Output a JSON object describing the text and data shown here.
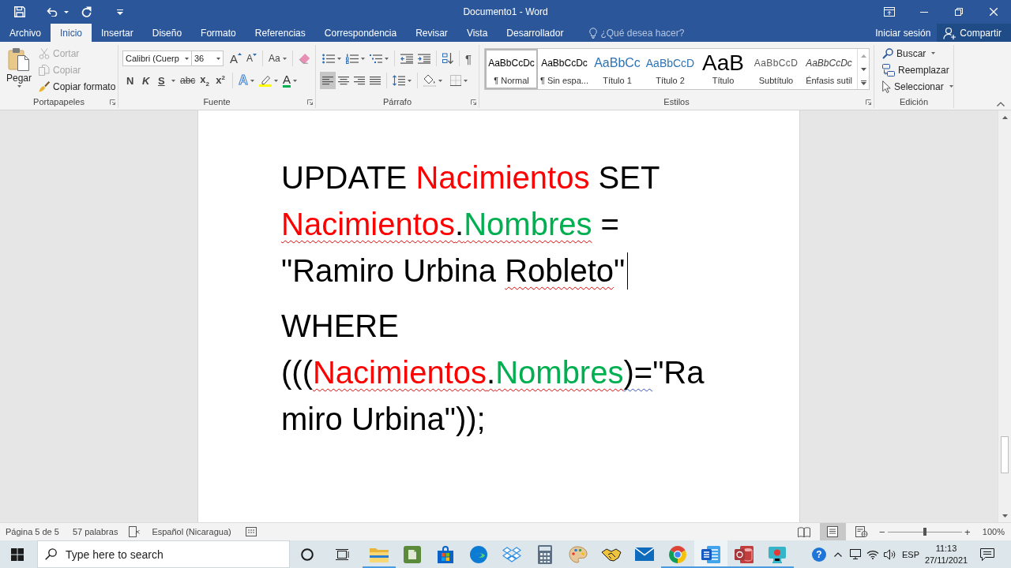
{
  "window": {
    "title": "Documento1 - Word"
  },
  "tabs": [
    {
      "label": "Archivo",
      "selected": false
    },
    {
      "label": "Inicio",
      "selected": true
    },
    {
      "label": "Insertar",
      "selected": false
    },
    {
      "label": "Diseño",
      "selected": false
    },
    {
      "label": "Formato",
      "selected": false
    },
    {
      "label": "Referencias",
      "selected": false
    },
    {
      "label": "Correspondencia",
      "selected": false
    },
    {
      "label": "Revisar",
      "selected": false
    },
    {
      "label": "Vista",
      "selected": false
    },
    {
      "label": "Desarrollador",
      "selected": false
    }
  ],
  "tell_me": {
    "placeholder": "¿Qué desea hacer?"
  },
  "account": {
    "sign_in": "Iniciar sesión",
    "share": "Compartir"
  },
  "ribbon": {
    "clipboard": {
      "label": "Portapapeles",
      "paste": "Pegar",
      "items": [
        {
          "kind": "cut",
          "label": "Cortar",
          "disabled": true
        },
        {
          "kind": "copy",
          "label": "Copiar",
          "disabled": true
        },
        {
          "kind": "format-painter",
          "label": "Copiar formato",
          "disabled": false
        }
      ]
    },
    "font": {
      "label": "Fuente",
      "font_name": "Calibri (Cuerp",
      "font_size": "36",
      "grow": "A",
      "shrink": "A",
      "change_case": "Aa",
      "styles": [
        {
          "kind": "bold",
          "label": "N"
        },
        {
          "kind": "italic",
          "label": "K"
        },
        {
          "kind": "underline",
          "label": "S"
        },
        {
          "kind": "strike",
          "label": "abc"
        },
        {
          "kind": "sub",
          "label": "x$_{2}$"
        },
        {
          "kind": "super",
          "label": "x$^{2}$"
        }
      ],
      "text_effects": "A",
      "font_color": "A"
    },
    "paragraph": {
      "label": "Párrafo",
      "marks": "¶",
      "alignment": [
        {
          "kind": "left",
          "selected": true
        },
        {
          "kind": "center",
          "selected": false
        },
        {
          "kind": "right",
          "selected": false
        },
        {
          "kind": "justify",
          "selected": false
        }
      ]
    },
    "styles": {
      "label": "Estilos",
      "gallery": [
        {
          "kind": "normal",
          "preview": "AaBbCcDc",
          "name": "¶ Normal",
          "selected": true
        },
        {
          "kind": "no-spacing",
          "preview": "AaBbCcDc",
          "name": "¶ Sin espa...",
          "selected": false
        },
        {
          "kind": "heading1",
          "preview": "AaBbCc",
          "name": "Título 1",
          "selected": false
        },
        {
          "kind": "heading2",
          "preview": "AaBbCcD",
          "name": "Título 2",
          "selected": false
        },
        {
          "kind": "title",
          "preview": "AaB",
          "name": "Título",
          "selected": false
        },
        {
          "kind": "subtitle",
          "preview": "AaBbCcD",
          "name": "Subtítulo",
          "selected": false
        },
        {
          "kind": "subtle-emphasis",
          "preview": "AaBbCcDc",
          "name": "Énfasis sutil",
          "selected": false
        }
      ]
    },
    "editing": {
      "label": "Edición",
      "items": [
        {
          "kind": "find",
          "label": "Buscar",
          "menu": true
        },
        {
          "kind": "replace",
          "label": "Reemplazar",
          "menu": false
        },
        {
          "kind": "select",
          "label": "Seleccionar",
          "menu": true
        }
      ]
    }
  },
  "document": {
    "paragraphs": [
      {
        "lines": [
          [
            {
              "text": "UPDATE "
            },
            {
              "text": "Nacimientos",
              "color": "#ff0000"
            },
            {
              "text": " SET"
            }
          ],
          [
            {
              "text": "Nacimientos",
              "color": "#ff0000",
              "spelling_error": true
            },
            {
              "text": ".",
              "spelling_error": true
            },
            {
              "text": "Nombres",
              "color": "#00b050",
              "spelling_error": true
            },
            {
              "text": " ="
            }
          ],
          [
            {
              "text": "\"Ramiro Urbina "
            },
            {
              "text": "Robleto",
              "spelling_error": true
            },
            {
              "text": "\"",
              "caret": true
            }
          ]
        ]
      },
      {
        "lines": [
          [
            {
              "text": "WHERE"
            }
          ],
          [
            {
              "text": "((("
            },
            {
              "text": "Nacimientos",
              "color": "#ff0000",
              "spelling_error": true
            },
            {
              "text": ".",
              "spelling_error": true
            },
            {
              "text": "Nombres",
              "color": "#00b050",
              "spelling_error": true
            },
            {
              "text": ")=",
              "grammar_error": true
            },
            {
              "text": "\"Ra"
            }
          ],
          [
            {
              "text": "miro Urbina\"));"
            }
          ]
        ]
      }
    ]
  },
  "status_bar": {
    "page": "Página 5 de 5",
    "words": "57 palabras",
    "language": "Español (Nicaragua)",
    "views": [
      {
        "kind": "read",
        "selected": false
      },
      {
        "kind": "print",
        "selected": true
      },
      {
        "kind": "web",
        "selected": false
      }
    ],
    "zoom": {
      "minus": "−",
      "plus": "+",
      "level": 0.5,
      "reading": "100%"
    }
  },
  "taskbar": {
    "search": {
      "placeholder": "Type here to search"
    },
    "apps": [
      {
        "kind": "files",
        "running": true,
        "selected": false
      },
      {
        "kind": "notes",
        "running": false,
        "selected": false
      },
      {
        "kind": "store",
        "running": false,
        "selected": false
      },
      {
        "kind": "web",
        "running": false,
        "selected": false
      },
      {
        "kind": "cloud",
        "running": false,
        "selected": false
      },
      {
        "kind": "calculator",
        "running": false,
        "selected": false
      },
      {
        "kind": "palette",
        "running": false,
        "selected": false
      },
      {
        "kind": "handshake",
        "running": false,
        "selected": false
      },
      {
        "kind": "mail",
        "running": false,
        "selected": false
      },
      {
        "kind": "web2",
        "running": true,
        "selected": false
      },
      {
        "kind": "writer",
        "running": true,
        "selected": true
      },
      {
        "kind": "database",
        "running": true,
        "selected": false
      },
      {
        "kind": "camera",
        "running": true,
        "selected": false
      }
    ],
    "tray": {
      "help": "?",
      "language": "ESP",
      "time": "11:13",
      "date": "27/11/2021"
    }
  }
}
